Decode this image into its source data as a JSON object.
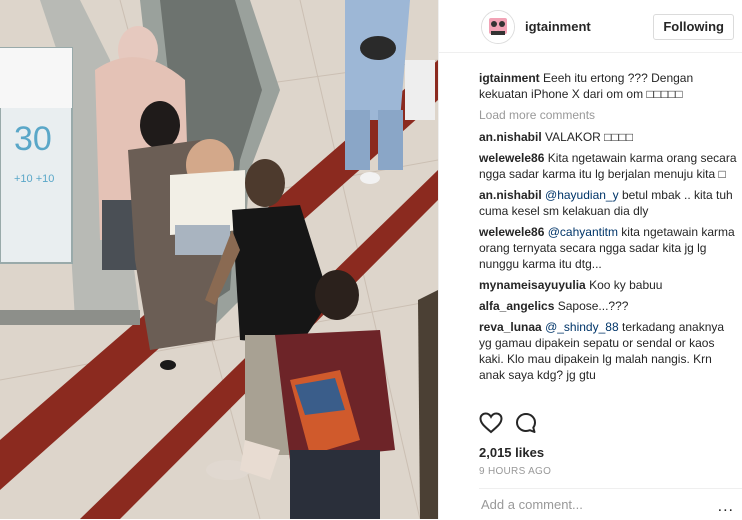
{
  "post": {
    "username": "igtainment",
    "follow_label": "Following",
    "caption_user": "igtainment",
    "caption_text": "Eeeh itu ertong ??? Dengan kekuatan iPhone X dari om om □□□□□",
    "load_more": "Load more comments",
    "likes": "2,015 likes",
    "time": "9 HOURS AGO",
    "add_comment_placeholder": "Add a comment...",
    "more_label": "..."
  },
  "comments": [
    {
      "user": "an.nishabil",
      "mention": "",
      "text": "VALAKOR □□□□"
    },
    {
      "user": "welewele86",
      "mention": "",
      "text": "Kita ngetawain karma orang secara ngga sadar karma itu lg berjalan menuju kita □"
    },
    {
      "user": "an.nishabil",
      "mention": "@hayudian_y",
      "text": "betul mbak .. kita tuh cuma kesel sm kelakuan dia dly"
    },
    {
      "user": "welewele86",
      "mention": "@cahyantitm",
      "text": "kita ngetawain karma orang ternyata secara ngga sadar kita jg lg nunggu karma itu dtg..."
    },
    {
      "user": "mynameisayuyulia",
      "mention": "",
      "text": "Koo ky babuu"
    },
    {
      "user": "alfa_angelics",
      "mention": "",
      "text": "Sapose...???"
    },
    {
      "user": "reva_lunaa",
      "mention": "@_shindy_88",
      "text": "terkadang anaknya yg gamau dipakein sepatu or sendal or kaos kaki. Klo mau dipakein lg malah nangis. Krn anak saya kdg? jg gtu"
    }
  ],
  "photo": {
    "sign_text": "30",
    "sign_sub": "+10 +10"
  },
  "colors": {
    "link": "#003569",
    "muted": "#999999",
    "border": "#efefef"
  }
}
